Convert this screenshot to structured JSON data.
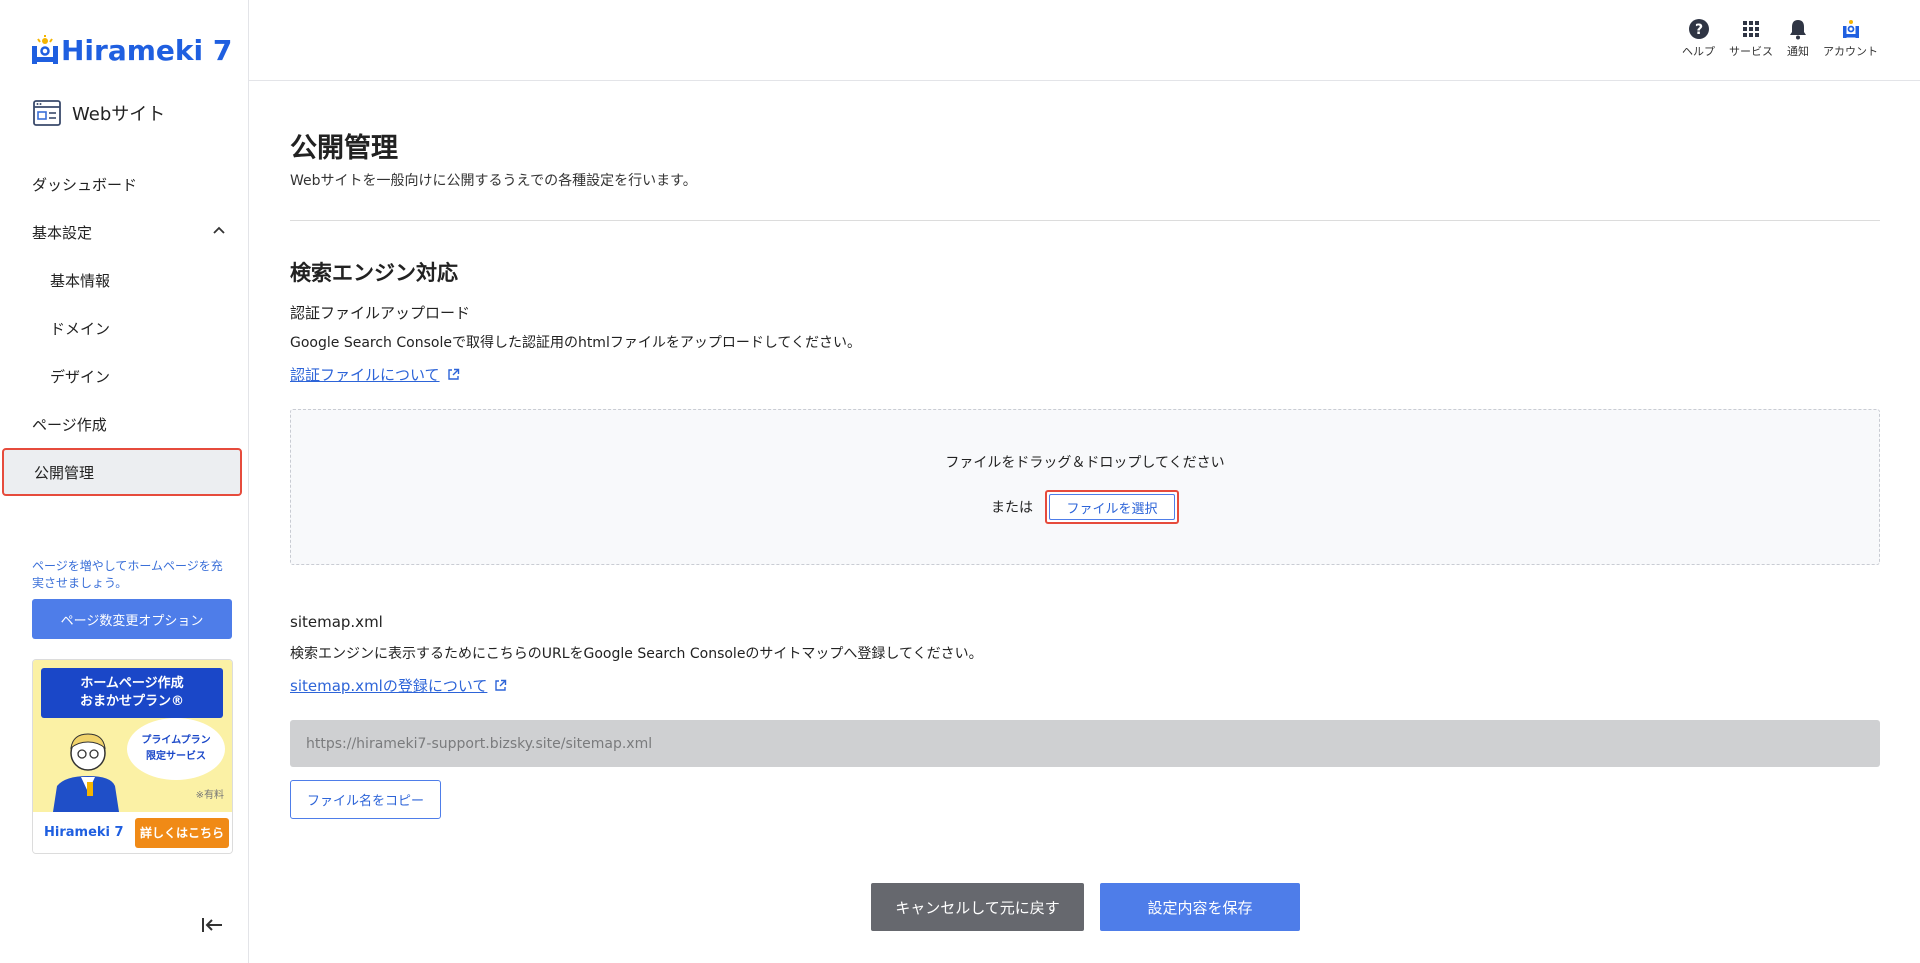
{
  "brand": {
    "name": "Hirameki 7",
    "accent": "#1f5fe0",
    "highlight": "#e64b3c"
  },
  "sidebar": {
    "site_label": "Webサイト",
    "items": [
      {
        "label": "ダッシュボード",
        "level": 1
      },
      {
        "label": "基本設定",
        "level": 1,
        "expanded": true
      },
      {
        "label": "基本情報",
        "level": 2
      },
      {
        "label": "ドメイン",
        "level": 2
      },
      {
        "label": "デザイン",
        "level": 2
      },
      {
        "label": "ページ作成",
        "level": 1
      },
      {
        "label": "公開管理",
        "level": 1,
        "active": true
      }
    ],
    "promo_text": "ページを増やしてホームページを充実させましょう。",
    "promo_button": "ページ数変更オプション",
    "banner": {
      "title_line1": "ホームページ作成",
      "title_line2": "おまかせプラン®",
      "bubble_line1": "プライムプラン",
      "bubble_line2": "限定サービス",
      "note": "※有料",
      "logo": "Hirameki 7",
      "cta": "詳しくはこちら"
    },
    "collapse_icon": "collapse-left-icon"
  },
  "header": {
    "actions": [
      {
        "label": "ヘルプ",
        "icon": "help-icon"
      },
      {
        "label": "サービス",
        "icon": "grid-icon"
      },
      {
        "label": "通知",
        "icon": "bell-icon"
      },
      {
        "label": "アカウント",
        "icon": "account-icon"
      }
    ]
  },
  "main": {
    "title": "公開管理",
    "description": "Webサイトを一般向けに公開するうえでの各種設定を行います。",
    "section_title": "検索エンジン対応",
    "auth": {
      "label": "認証ファイルアップロード",
      "description": "Google Search Consoleで取得した認証用のhtmlファイルをアップロードしてください。",
      "link": "認証ファイルについて",
      "dropzone_text": "ファイルをドラッグ＆ドロップしてください",
      "or_text": "または",
      "select_button": "ファイルを選択"
    },
    "sitemap": {
      "label": "sitemap.xml",
      "description": "検索エンジンに表示するためにこちらのURLをGoogle Search Consoleのサイトマップへ登録してください。",
      "link": "sitemap.xmlの登録について",
      "url": "https://hirameki7-support.bizsky.site/sitemap.xml",
      "copy_button": "ファイル名をコピー"
    },
    "cancel_button": "キャンセルして元に戻す",
    "save_button": "設定内容を保存"
  }
}
